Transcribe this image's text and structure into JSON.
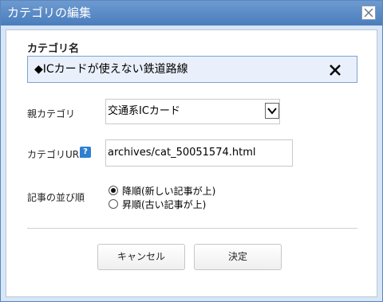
{
  "dialog": {
    "title": "カテゴリの編集",
    "close_icon": "close-icon"
  },
  "form": {
    "name_label": "カテゴリ名",
    "name_value": "◆ICカードが使えない鉄道路線",
    "clear_icon": "x-icon",
    "parent_label": "親カテゴリ",
    "parent_selected": "交通系ICカード",
    "url_label": "カテゴリURL",
    "help_icon": "?",
    "url_value": "archives/cat_50051574.html",
    "order_label": "記事の並び順",
    "order_options": [
      {
        "label": "降順(新しい記事が上)",
        "checked": true
      },
      {
        "label": "昇順(古い記事が上)",
        "checked": false
      }
    ]
  },
  "buttons": {
    "cancel": "キャンセル",
    "ok": "決定"
  }
}
